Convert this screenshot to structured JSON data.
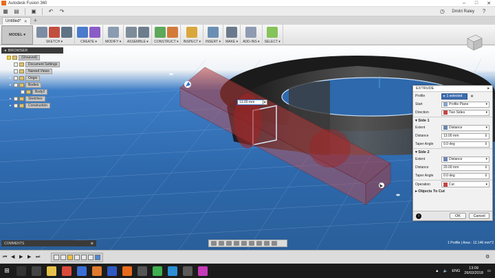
{
  "window": {
    "title": "Autodesk Fusion 360",
    "controls": [
      "–",
      "□",
      "✕"
    ]
  },
  "quickbar": {
    "user_name": "Dmitri Raley"
  },
  "tabs": [
    {
      "label": "Untitled*"
    }
  ],
  "toolbar": {
    "workspace": "MODEL ▾",
    "groups": [
      {
        "label": "SKETCH ▾",
        "colors": [
          "#7c8da3",
          "#c24e3f",
          "#607386"
        ]
      },
      {
        "label": "CREATE ▾",
        "colors": [
          "#4a7ccb",
          "#8a5cc7"
        ]
      },
      {
        "label": "MODIFY ▾",
        "colors": [
          "#8b9cb0"
        ]
      },
      {
        "label": "ASSEMBLE ▾",
        "colors": [
          "#7e8c9a",
          "#6d7d8d"
        ]
      },
      {
        "label": "CONSTRUCT ▾",
        "colors": [
          "#5da85a",
          "#d37a3a"
        ]
      },
      {
        "label": "INSPECT ▾",
        "colors": [
          "#d9a73b"
        ]
      },
      {
        "label": "INSERT ▾",
        "colors": [
          "#6b8fb3"
        ]
      },
      {
        "label": "MAKE ▾",
        "colors": [
          "#6a7a8c"
        ]
      },
      {
        "label": "ADD-INS ▾",
        "colors": [
          "#8f9bb0"
        ]
      },
      {
        "label": "SELECT ▾",
        "colors": [
          "#86c35a"
        ]
      }
    ]
  },
  "browser": {
    "title": "BROWSER",
    "items": [
      {
        "label": "(Unsaved)",
        "indent": 0,
        "icon": "bulb"
      },
      {
        "label": "Document Settings",
        "indent": 1,
        "icon": "gear"
      },
      {
        "label": "Named Views",
        "indent": 1,
        "icon": "folder"
      },
      {
        "label": "Origin",
        "indent": 1,
        "icon": "folder"
      },
      {
        "label": "Bodies",
        "indent": 1,
        "icon": "folder"
      },
      {
        "label": "Body2",
        "indent": 2,
        "icon": "body"
      },
      {
        "label": "Sketches",
        "indent": 1,
        "icon": "folder"
      },
      {
        "label": "Construction",
        "indent": 1,
        "icon": "folder"
      }
    ]
  },
  "canvas": {
    "distance_value": "13.00 mm"
  },
  "extrude": {
    "title": "EXTRUDE",
    "profile_label": "Profile",
    "profile_value": "1 selected",
    "start_label": "Start",
    "start_value": "Profile Plane",
    "direction_label": "Direction",
    "direction_value": "Two Sides",
    "side1_title": "Side 1",
    "side1_extent_label": "Extent",
    "side1_extent_value": "Distance",
    "side1_distance_label": "Distance",
    "side1_distance_value": "13.00 mm",
    "side1_taper_label": "Taper Angle",
    "side1_taper_value": "0.0 deg",
    "side2_title": "Side 2",
    "side2_extent_label": "Extent",
    "side2_extent_value": "Distance",
    "side2_distance_label": "Distance",
    "side2_distance_value": "20.00 mm",
    "side2_taper_label": "Taper Angle",
    "side2_taper_value": "0.0 deg",
    "operation_label": "Operation",
    "operation_value": "Cut",
    "objects_to_cut": "Objects To Cut",
    "ok_label": "OK",
    "cancel_label": "Cancel"
  },
  "comments": {
    "title": "COMMENTS"
  },
  "status": {
    "text": "1 Profile | Area : 12.146 mm^2"
  },
  "taskbar": {
    "language": "ENG",
    "time": "13:09",
    "date": "26/02/2018"
  }
}
